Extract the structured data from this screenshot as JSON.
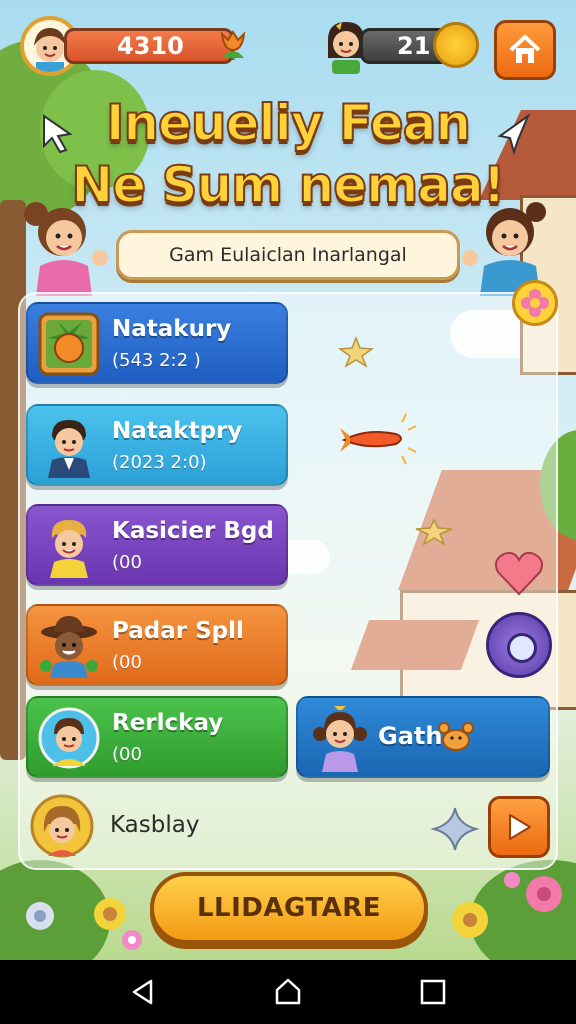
{
  "hud": {
    "coins": "4310",
    "gems": "21"
  },
  "title": {
    "line1": "Ineueliy Fean",
    "line2": "Ne Sum nemaa!"
  },
  "subtitle": "Gam Eulaiclan Inarlangal",
  "cards": [
    {
      "name": "Natakury",
      "sub": "(​543 2:2 )",
      "color": "blue",
      "thumb": "fruit-icon"
    },
    {
      "name": "Nataktpry",
      "sub": "(2023 2:0)",
      "color": "cyan",
      "thumb": "boy-avatar"
    },
    {
      "name": "Kasicier Bgd",
      "sub": "(00",
      "color": "purple",
      "thumb": "blond-kid-avatar"
    },
    {
      "name": "Padar Spll",
      "sub": "(00",
      "color": "orange",
      "thumb": "cowboy-avatar"
    },
    {
      "name": "Rerlckay",
      "sub": "(00",
      "color": "green",
      "thumb": "kid-avatar"
    }
  ],
  "gath": {
    "name": "Gath",
    "icon": "crab-icon"
  },
  "last_row": {
    "name": "Kasblay"
  },
  "main_button": "LLIDAGTARE",
  "colors": {
    "accent": "#f49a14",
    "title": "#ffd23a",
    "title_outline": "#7a3a12"
  }
}
